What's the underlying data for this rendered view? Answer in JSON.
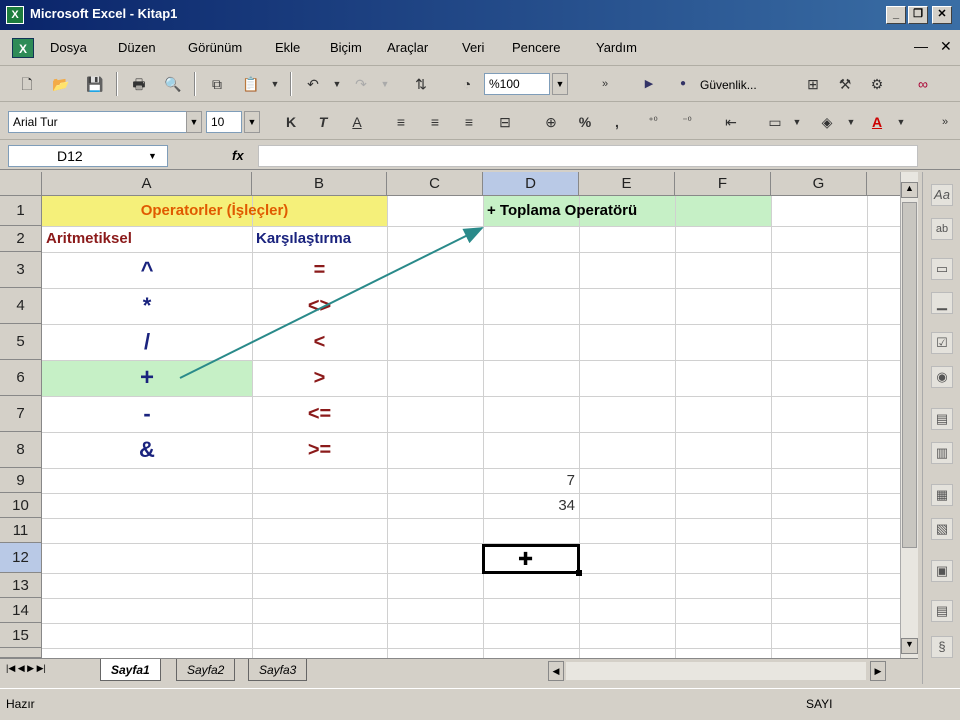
{
  "window": {
    "title": "Microsoft Excel - Kitap1",
    "app_icon": "excel-icon"
  },
  "menu": [
    "Dosya",
    "Düzen",
    "Görünüm",
    "Ekle",
    "Biçim",
    "Araçlar",
    "Veri",
    "Pencere",
    "Yardım"
  ],
  "toolbar": {
    "zoom": "%100",
    "security_label": "Güvenlik..."
  },
  "format_toolbar": {
    "font_name": "Arial Tur",
    "font_size": "10",
    "bold": "K",
    "italic": "T",
    "underline": "A",
    "percent": "%",
    "comma": ","
  },
  "formula_bar": {
    "name_box": "D12",
    "fx": "fx",
    "formula": ""
  },
  "columns": [
    "A",
    "B",
    "C",
    "D",
    "E",
    "F",
    "G"
  ],
  "rows": [
    "1",
    "2",
    "3",
    "4",
    "5",
    "6",
    "7",
    "8",
    "9",
    "10",
    "11",
    "12",
    "13",
    "14",
    "15"
  ],
  "cells": {
    "A1": "Operatorler (İşleçler)",
    "D1": "+ Toplama Operatörü",
    "A2": "Aritmetiksel",
    "B2": "Karşılaştırma",
    "A3": "^",
    "B3": "=",
    "A4": "*",
    "B4": "<>",
    "A5": "/",
    "B5": "<",
    "A6": "+",
    "B6": ">",
    "A7": "-",
    "B7": "<=",
    "A8": "&",
    "B8": ">=",
    "D9": "7",
    "D10": "34"
  },
  "colors": {
    "title_yellow": "#f5f07a",
    "green_fill": "#c6f0c6",
    "orange_text": "#e05a00",
    "red_text": "#8b1a1a",
    "blue_text": "#1a237e",
    "arrow": "#2a8a8a"
  },
  "sheets": [
    "Sayfa1",
    "Sayfa2",
    "Sayfa3"
  ],
  "status": {
    "left": "Hazır",
    "right": "SAYI"
  }
}
